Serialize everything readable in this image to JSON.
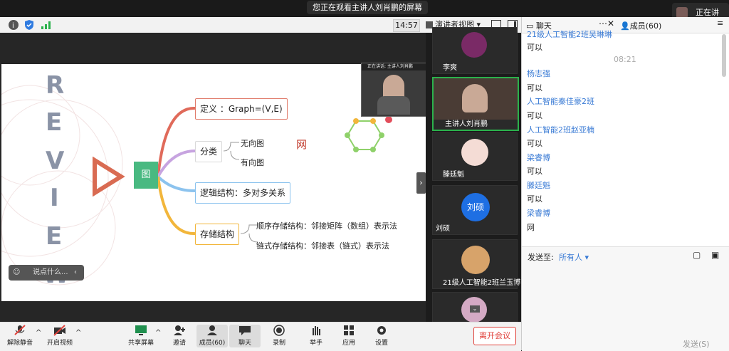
{
  "window": {
    "sharing_banner": "您正在观看主讲人刘肖鹏的屏幕",
    "speaking_label": "正在讲话:",
    "timer": "14:57",
    "view_mode": "演讲者视图"
  },
  "slide": {
    "review_letters": [
      "R",
      "E",
      "V",
      "I",
      "E",
      "W"
    ],
    "center_node": "图",
    "branch_definition": "定义 ：Graph=(V,E)",
    "branch_classification": "分类",
    "class_undirected": "无向图",
    "class_directed": "有向图",
    "branch_logic": "逻辑结构：多对多关系",
    "branch_storage": "存储结构",
    "storage_sequential": "顺序存储结构：邻接矩阵（数组）表示法",
    "storage_linked": "链式存储结构：邻接表（链式）表示法",
    "handwriting": "网",
    "comment_placeholder": "说点什么...",
    "speaker_caption": "正在讲话: 主讲人刘肖鹏"
  },
  "participants": [
    {
      "name": "李爽",
      "kind": "photo"
    },
    {
      "name": "主讲人刘肖鹏",
      "kind": "video"
    },
    {
      "name": "滕廷魁",
      "kind": "photo"
    },
    {
      "name": "刘硕",
      "kind": "initials",
      "initials": "刘硕"
    },
    {
      "name": "21级人工智能2班兰玉博",
      "kind": "photo"
    },
    {
      "name": "",
      "kind": "photo"
    }
  ],
  "bottom_toolbar": {
    "mute": "解除静音",
    "video": "开启视频",
    "share": "共享屏幕",
    "invite": "邀请",
    "members": "成员(60)",
    "chat": "聊天",
    "record": "录制",
    "raise_hand": "举手",
    "apps": "应用",
    "settings": "设置",
    "leave": "离开会议"
  },
  "chat": {
    "tab_chat": "聊天",
    "tab_members": "成员(60)",
    "clipped_top": "21级人工智能2班吴琳琳",
    "first_msg": "可以",
    "time": "08:21",
    "messages": [
      {
        "name": "杨志强",
        "text": "可以"
      },
      {
        "name": "人工智能秦佳豪2班",
        "text": "可以"
      },
      {
        "name": "人工智能2班赵亚楠",
        "text": "可以"
      },
      {
        "name": "梁睿博",
        "text": "可以"
      },
      {
        "name": "滕廷魁",
        "text": "可以"
      },
      {
        "name": "梁睿博",
        "text": "网"
      }
    ],
    "send_to_label": "发送至:",
    "send_to_value": "所有人",
    "send_button": "发送(S)"
  },
  "colors": {
    "accent_blue": "#3a7bd5",
    "leave_red": "#e0413b",
    "node_green": "#49b981"
  }
}
